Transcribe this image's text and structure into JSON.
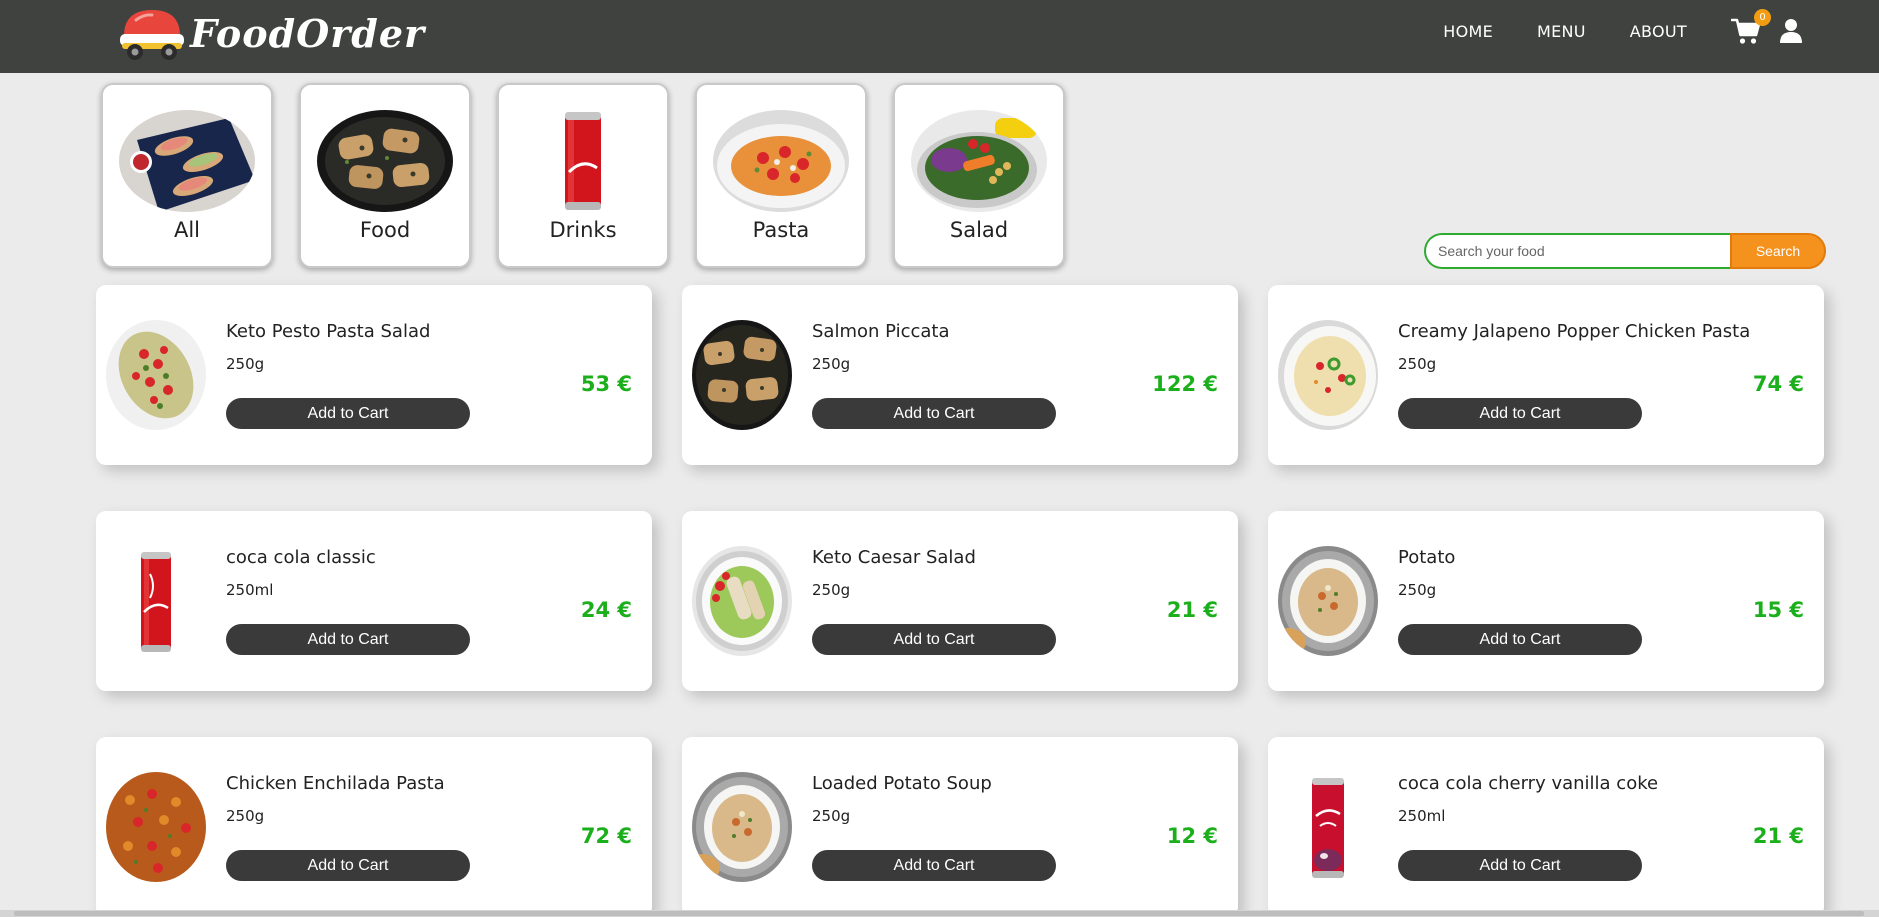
{
  "brand": {
    "name": "FoodOrder"
  },
  "nav": {
    "links": [
      "HOME",
      "MENU",
      "ABOUT"
    ],
    "cart_count": "0"
  },
  "categories": [
    "All",
    "Food",
    "Drinks",
    "Pasta",
    "Salad"
  ],
  "search": {
    "placeholder": "Search your food",
    "button_label": "Search"
  },
  "products": [
    {
      "name": "Keto Pesto Pasta Salad",
      "weight": "250g",
      "price": "53 €",
      "image": "pesto-pasta-salad",
      "add_label": "Add to Cart"
    },
    {
      "name": "Salmon Piccata",
      "weight": "250g",
      "price": "122 €",
      "image": "salmon-pan",
      "add_label": "Add to Cart"
    },
    {
      "name": "Creamy Jalapeno Popper Chicken Pasta",
      "weight": "250g",
      "price": "74 €",
      "image": "creamy-pasta",
      "add_label": "Add to Cart"
    },
    {
      "name": "coca cola classic",
      "weight": "250ml",
      "price": "24 €",
      "image": "coca-cola-can",
      "add_label": "Add to Cart"
    },
    {
      "name": "Keto Caesar Salad",
      "weight": "250g",
      "price": "21 €",
      "image": "caesar-salad",
      "add_label": "Add to Cart"
    },
    {
      "name": "Potato",
      "weight": "250g",
      "price": "15 €",
      "image": "potato-soup",
      "add_label": "Add to Cart"
    },
    {
      "name": "Chicken Enchilada Pasta",
      "weight": "250g",
      "price": "72 €",
      "image": "enchilada-pasta",
      "add_label": "Add to Cart"
    },
    {
      "name": "Loaded Potato Soup",
      "weight": "250g",
      "price": "12 €",
      "image": "potato-soup",
      "add_label": "Add to Cart"
    },
    {
      "name": "coca cola cherry vanilla coke",
      "weight": "250ml",
      "price": "21 €",
      "image": "cherry-coke-can",
      "add_label": "Add to Cart"
    }
  ],
  "colors": {
    "navbar": "#3f423f",
    "background": "#ebebeb",
    "price": "#1bb01b",
    "search_button": "#f5921e",
    "search_border": "#2eaa2e",
    "cart_badge": "#f39c12",
    "add_button": "#3a3a3a"
  }
}
